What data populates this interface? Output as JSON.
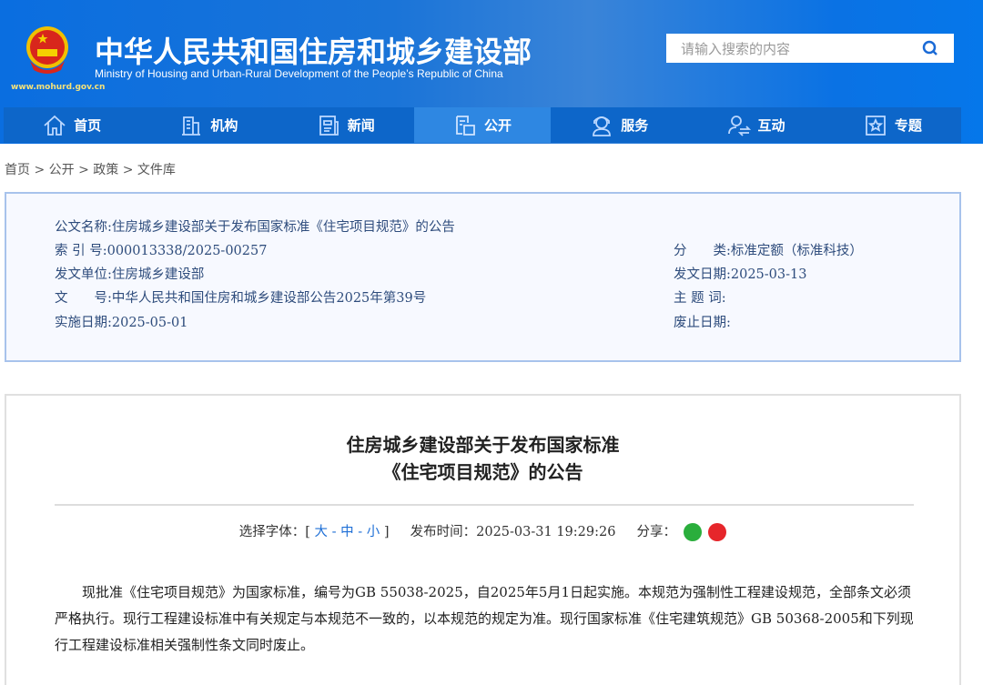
{
  "header": {
    "title_cn": "中华人民共和国住房和城乡建设部",
    "title_en": "Ministry of Housing and Urban-Rural Development of the People’s Republic of China",
    "url": "www.mohurd.gov.cn",
    "search_placeholder": "请输入搜索的内容"
  },
  "nav": [
    {
      "label": "首页",
      "icon": "home-icon"
    },
    {
      "label": "机构",
      "icon": "building-icon"
    },
    {
      "label": "新闻",
      "icon": "news-icon"
    },
    {
      "label": "公开",
      "icon": "document-icon"
    },
    {
      "label": "服务",
      "icon": "service-icon"
    },
    {
      "label": "互动",
      "icon": "interact-icon"
    },
    {
      "label": "专题",
      "icon": "star-icon"
    }
  ],
  "breadcrumb": "首页 > 公开 > 政策 > 文件库",
  "info": {
    "name": "公文名称:住房城乡建设部关于发布国家标准《住宅项目规范》的公告",
    "index": "索 引 号:000013338/2025-00257",
    "category": "分　　类:标准定额（标准科技）",
    "issuer": "发文单位:住房城乡建设部",
    "issue_date": "发文日期:2025-03-13",
    "doc_no": "文　　号:中华人民共和国住房和城乡建设部公告2025年第39号",
    "subject": "主 题 词:",
    "effective": "实施日期:2025-05-01",
    "abolish": "废止日期:"
  },
  "article": {
    "title1": "住房城乡建设部关于发布国家标准",
    "title2": "《住宅项目规范》的公告",
    "font_label": "选择字体：[",
    "font_large": "大",
    "font_mid": "中",
    "font_small": "小",
    "font_close": "]",
    "publish_label": "发布时间：",
    "publish_time": "2025-03-31 19:29:26",
    "share_label": "分享：",
    "body": "现批准《住宅项目规范》为国家标准，编号为GB 55038-2025，自2025年5月1日起实施。本规范为强制性工程建设规范，全部条文必须严格执行。现行工程建设标准中有关规定与本规范不一致的，以本规范的规定为准。现行国家标准《住宅建筑规范》GB 50368-2005和下列现行工程建设标准相关强制性条文同时废止。"
  }
}
